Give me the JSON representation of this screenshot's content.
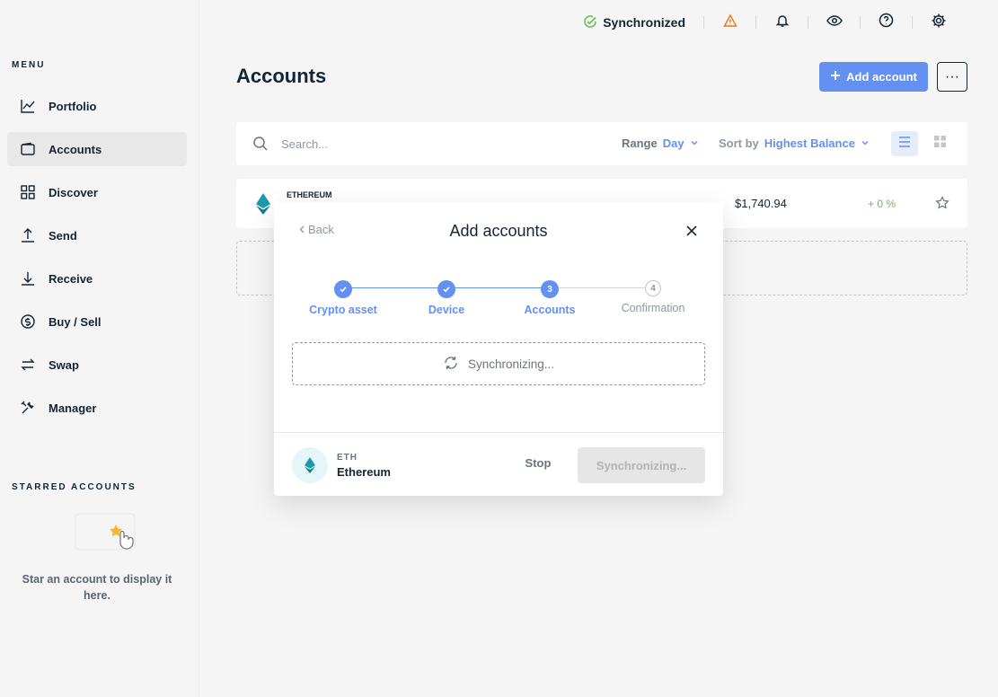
{
  "topbar": {
    "sync_label": "Synchronized",
    "icons": [
      "sync-check-icon",
      "warning-icon",
      "bell-icon",
      "eye-icon",
      "help-icon",
      "settings-icon"
    ]
  },
  "sidebar": {
    "menu_title": "MENU",
    "items": [
      {
        "label": "Portfolio",
        "icon": "chart-icon"
      },
      {
        "label": "Accounts",
        "icon": "wallet-icon",
        "active": true
      },
      {
        "label": "Discover",
        "icon": "grid-icon"
      },
      {
        "label": "Send",
        "icon": "send-icon"
      },
      {
        "label": "Receive",
        "icon": "receive-icon"
      },
      {
        "label": "Buy / Sell",
        "icon": "dollar-icon"
      },
      {
        "label": "Swap",
        "icon": "swap-icon"
      },
      {
        "label": "Manager",
        "icon": "tools-icon"
      }
    ],
    "starred_title": "STARRED ACCOUNTS",
    "starred_empty": "Star an account to display it here."
  },
  "main": {
    "title": "Accounts",
    "add_account_label": "Add account",
    "more_label": "···",
    "search_placeholder": "Search...",
    "range_label": "Range",
    "range_value": "Day",
    "sort_label": "Sort by",
    "sort_value": "Highest Balance",
    "account_row": {
      "ticker": "ETHEREUM",
      "fiat": "$1,740.94",
      "change": "+ 0 %"
    }
  },
  "modal": {
    "back_label": "Back",
    "title": "Add accounts",
    "steps": [
      {
        "label": "Crypto asset",
        "state": "done",
        "number": "1"
      },
      {
        "label": "Device",
        "state": "done",
        "number": "2"
      },
      {
        "label": "Accounts",
        "state": "current",
        "number": "3"
      },
      {
        "label": "Confirmation",
        "state": "future",
        "number": "4"
      }
    ],
    "sync_text": "Synchronizing...",
    "coin_ticker": "ETH",
    "coin_name": "Ethereum",
    "stop_label": "Stop",
    "sync_button_label": "Synchronizing..."
  },
  "colors": {
    "accent": "#6490f1",
    "success": "#66be54",
    "warning": "#ea7b24",
    "ethereum": "#1a9ca8"
  }
}
